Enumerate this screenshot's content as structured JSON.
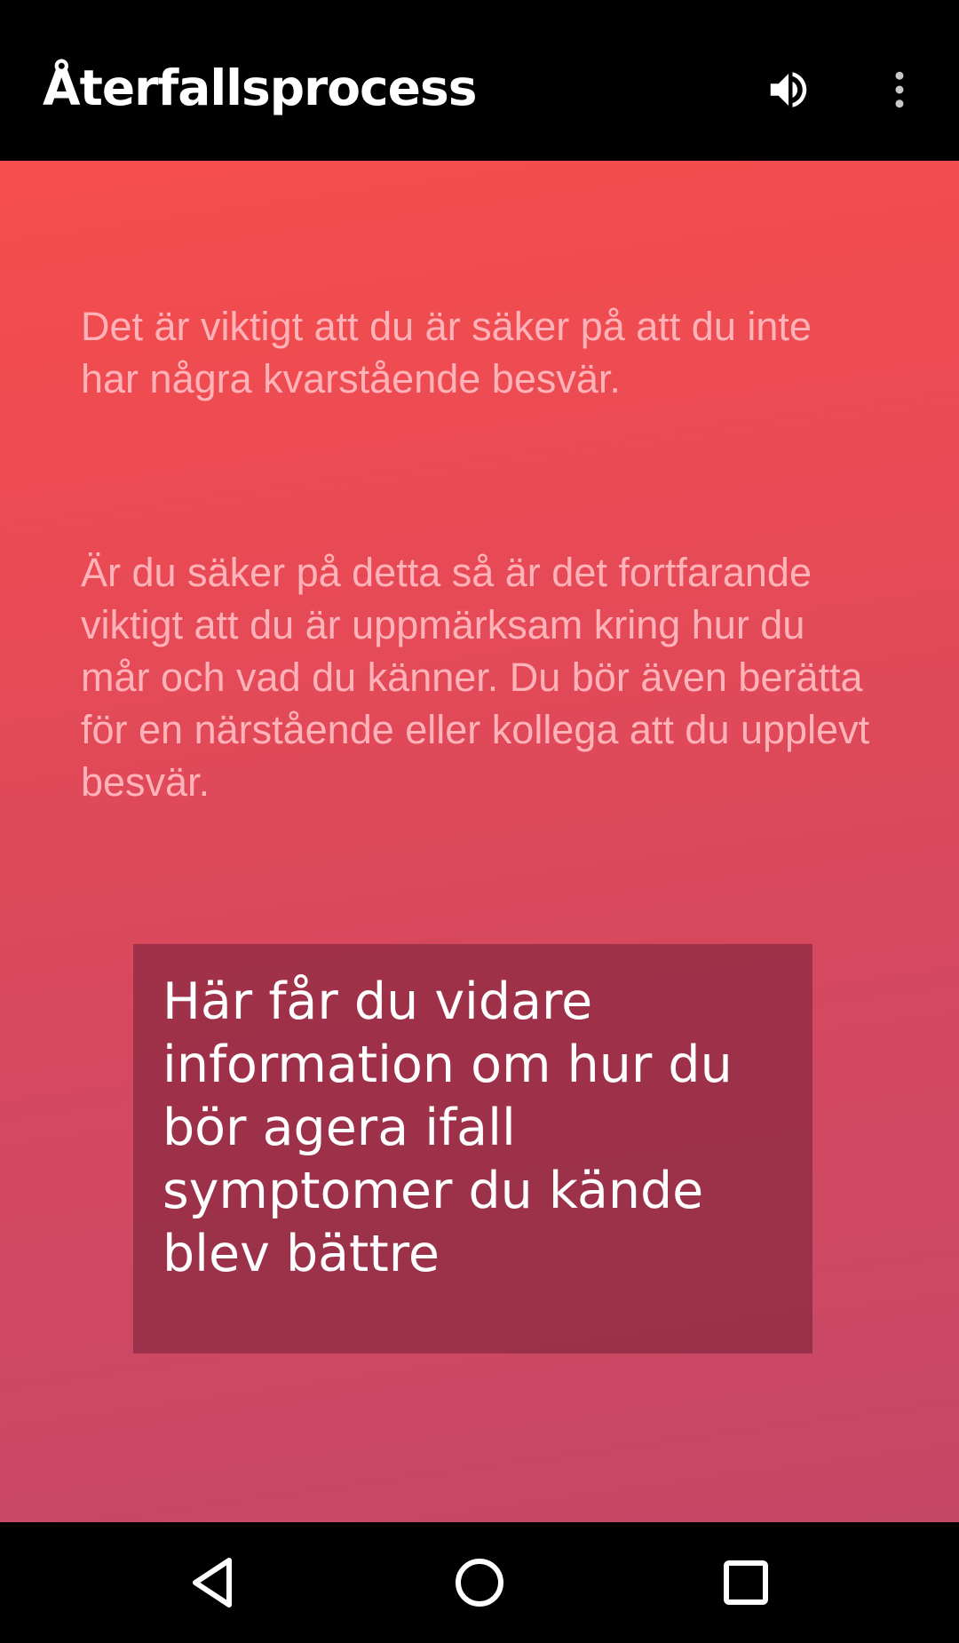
{
  "app_bar": {
    "title": "Återfallsprocess",
    "icons": [
      "volume-icon",
      "more-vert-icon"
    ]
  },
  "content": {
    "paragraph_1": "Det är viktigt att du är säker på att du inte har några kvarstående besvär.",
    "paragraph_2": "Är du säker på detta så är det fortfarande viktigt att du är uppmärksam kring hur du mår och vad du känner. Du bör även berätta för en närstående eller kollega att du upplevt besvär.",
    "info_button": "Här får du vidare information om hur du bör agera ifall symptomer du kände blev bättre"
  },
  "nav_bar": {
    "icons": [
      "back-icon",
      "home-icon",
      "recents-icon"
    ]
  },
  "colors": {
    "gradient_top": "#f64e4c",
    "gradient_bottom": "#c54866",
    "paragraph_text": "#ffb3b9",
    "info_box": "#9a3349"
  }
}
